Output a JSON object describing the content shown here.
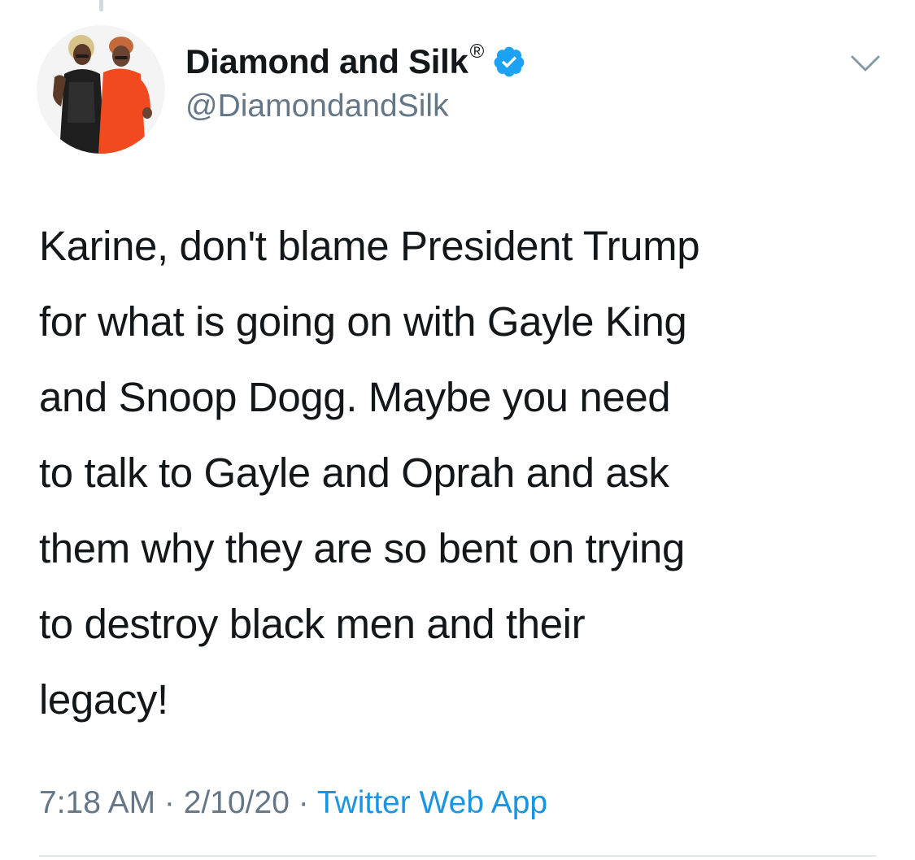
{
  "tweet": {
    "author": {
      "name": "Diamond and Silk",
      "registered_mark": "®",
      "handle": "@DiamondandSilk",
      "verified": true,
      "avatar_icon": "avatar-photo-two-women"
    },
    "text": "Karine, don't blame President Trump\nfor what is going on with Gayle King\nand Snoop Dogg. Maybe you need\nto talk to Gayle and Oprah and ask\nthem why they are so bent on trying\nto destroy black men and their\nlegacy!",
    "time": "7:18 AM",
    "separator": " · ",
    "date": "2/10/20",
    "source": "Twitter Web App",
    "menu_icon": "chevron-down-icon"
  },
  "colors": {
    "text": "#14171a",
    "secondary": "#657786",
    "link": "#1b95e0",
    "verified": "#1da1f2",
    "divider": "#e1e8ed"
  }
}
